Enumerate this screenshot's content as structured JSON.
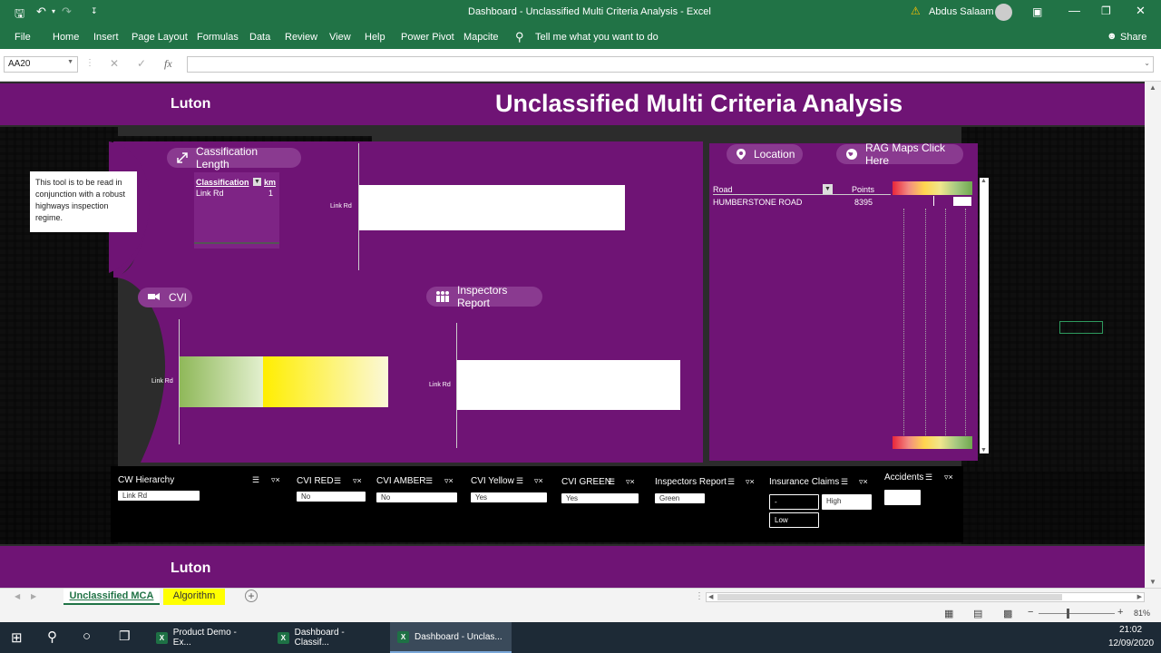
{
  "window": {
    "title": "Dashboard - Unclassified Multi Criteria Analysis  -  Excel",
    "user": "Abdus Salaam"
  },
  "ribbon": {
    "tabs": [
      "File",
      "Home",
      "Insert",
      "Page Layout",
      "Formulas",
      "Data",
      "Review",
      "View",
      "Help",
      "Power Pivot",
      "Mapcite"
    ],
    "tell_me": "Tell me what you want to do",
    "share": "Share"
  },
  "formula_bar": {
    "name_box": "AA20",
    "fx": "fx",
    "formula": ""
  },
  "dashboard": {
    "brand_top": "Luton",
    "brand_bottom": "Luton",
    "heading": "Unclassified Multi Criteria Analysis",
    "note": "This tool is to be read in conjunction with a robust highways inspection regime.",
    "classification_panel": {
      "label": "Cassification Length",
      "col1": "Classification",
      "col2": "km",
      "row_name": "Link Rd",
      "row_value": "1",
      "chart_label": "Link Rd"
    },
    "cvi_panel": {
      "label": "CVI",
      "chart_label": "Link Rd"
    },
    "inspectors_panel": {
      "label": "Inspectors Report",
      "chart_label": "Link Rd"
    },
    "location_panel": {
      "location_label": "Location",
      "rag_label": "RAG Maps Click Here",
      "col_road": "Road",
      "col_points": "Points",
      "road": "HUMBERSTONE ROAD",
      "points": "8395"
    },
    "slicers": [
      {
        "title": "CW Hierarchy",
        "items": [
          "Link Rd"
        ]
      },
      {
        "title": "CVI RED",
        "items": [
          "No"
        ]
      },
      {
        "title": "CVI AMBER",
        "items": [
          "No"
        ]
      },
      {
        "title": "CVI Yellow",
        "items": [
          "Yes"
        ]
      },
      {
        "title": "CVI GREEN",
        "items": [
          "Yes"
        ]
      },
      {
        "title": "Inspectors Report",
        "items": [
          "Green"
        ]
      },
      {
        "title": "Insurance Claims",
        "items": [
          "-",
          "High",
          "Low"
        ]
      },
      {
        "title": "Accidents",
        "items": [
          ""
        ]
      }
    ]
  },
  "sheet_tabs": [
    "Unclassified MCA",
    "Algorithm"
  ],
  "status": {
    "zoom": "81%"
  },
  "taskbar": {
    "apps": [
      "Product Demo - Ex...",
      "Dashboard - Classif...",
      "Dashboard - Unclas..."
    ],
    "time": "21:02",
    "date": "12/09/2020"
  },
  "colors": {
    "excel_green": "#217346",
    "purple": "#6f1475",
    "pill": "#8a3a90"
  }
}
